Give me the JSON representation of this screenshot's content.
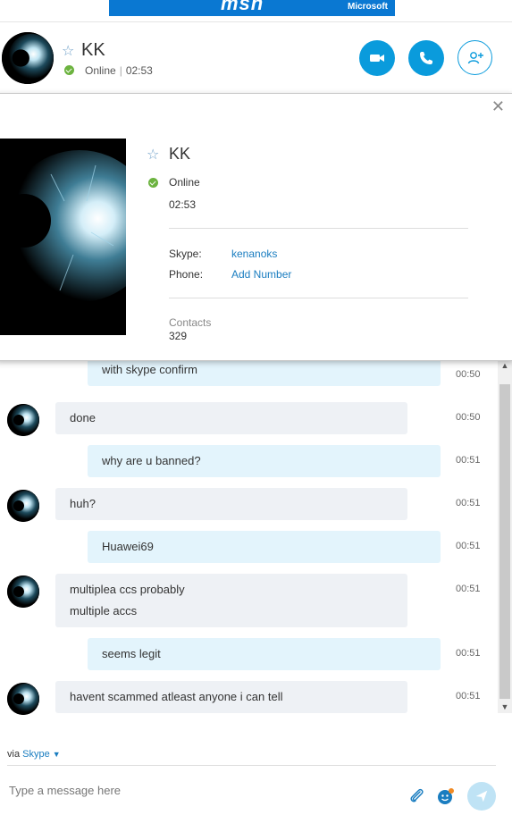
{
  "banner": {
    "logo": "msn",
    "brand": "Microsoft"
  },
  "header": {
    "name": "KK",
    "status": "Online",
    "status_time": "02:53",
    "status_color": "#6cb33f",
    "actions": [
      "video-call",
      "audio-call",
      "add-people"
    ],
    "accent": "#0a9bdc"
  },
  "profile": {
    "name": "KK",
    "status": "Online",
    "local_time": "02:53",
    "skype_label": "Skype:",
    "skype_value": "kenanoks",
    "phone_label": "Phone:",
    "phone_value": "Add Number",
    "contacts_label": "Contacts",
    "contacts_count": "329"
  },
  "messages": [
    {
      "dir": "out",
      "lines": [
        "with skype confirm"
      ],
      "time": "00:50"
    },
    {
      "dir": "in",
      "lines": [
        "done"
      ],
      "time": "00:50"
    },
    {
      "dir": "out",
      "lines": [
        "why are u banned?"
      ],
      "time": "00:51"
    },
    {
      "dir": "in",
      "lines": [
        "huh?"
      ],
      "time": "00:51"
    },
    {
      "dir": "out",
      "lines": [
        "Huawei69"
      ],
      "time": "00:51"
    },
    {
      "dir": "in",
      "lines": [
        "multiplea ccs probably",
        "multiple accs"
      ],
      "time": "00:51"
    },
    {
      "dir": "out",
      "lines": [
        "seems legit"
      ],
      "time": "00:51"
    },
    {
      "dir": "in",
      "lines": [
        "havent scammed atleast anyone i can tell"
      ],
      "time": "00:51"
    }
  ],
  "footer": {
    "via_label": "via",
    "via_service": "Skype",
    "input_placeholder": "Type a message here"
  }
}
